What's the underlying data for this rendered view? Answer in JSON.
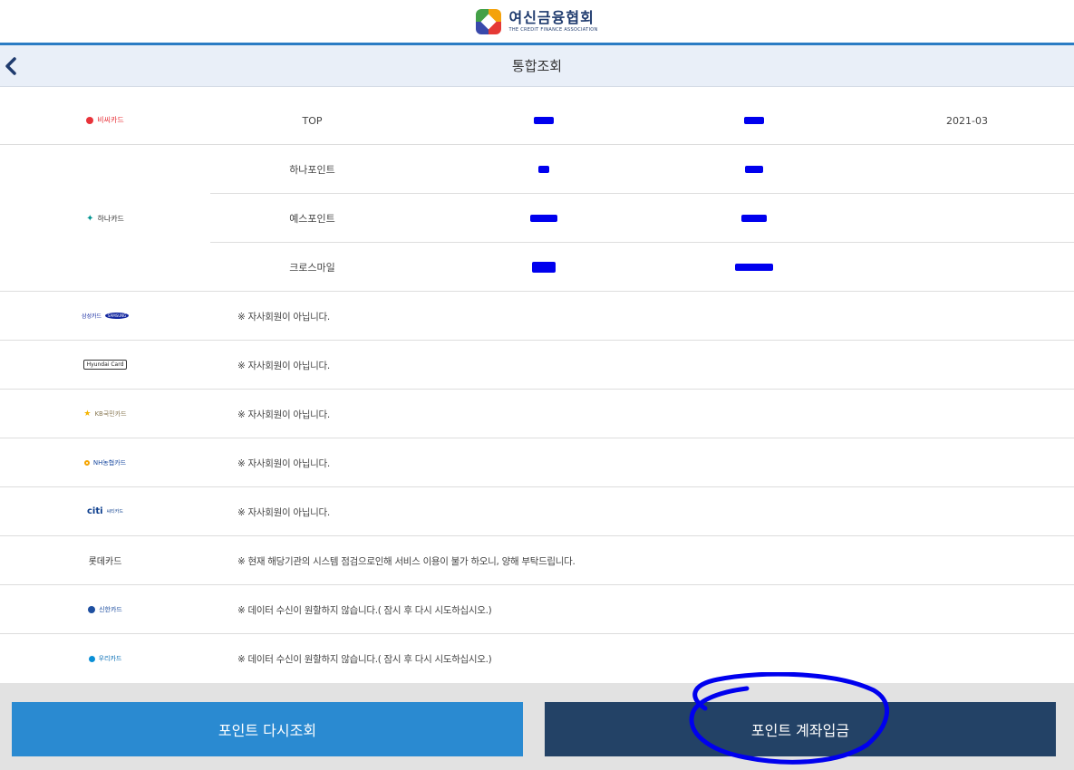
{
  "brand": {
    "name_ko": "여신금융협회",
    "name_en": "THE CREDIT FINANCE ASSOCIATION"
  },
  "header": {
    "title": "통합조회",
    "back_icon": "chevron-left-icon"
  },
  "cards": {
    "bc": {
      "logo_text": "비씨카드",
      "point_name": "TOP",
      "date": "2021-03"
    },
    "hana": {
      "logo_text": "하나카드",
      "points": [
        {
          "name": "하나포인트"
        },
        {
          "name": "예스포인트"
        },
        {
          "name": "크로스마일"
        }
      ]
    },
    "samsung": {
      "logo_text": "삼성카드",
      "brand_text": "SAMSUNG",
      "message": "※ 자사회원이 아닙니다."
    },
    "hyundai": {
      "logo_text": "Hyundai Card",
      "message": "※ 자사회원이 아닙니다."
    },
    "kb": {
      "logo_text": "KB국민카드",
      "message": "※ 자사회원이 아닙니다."
    },
    "nh": {
      "logo_text": "NH농협카드",
      "message": "※ 자사회원이 아닙니다."
    },
    "citi": {
      "logo_text": "citi",
      "sub_text": "씨티카드",
      "message": "※ 자사회원이 아닙니다."
    },
    "lotte": {
      "logo_text": "롯데카드",
      "message": "※ 현재 해당기관의 시스템 점검으로인해 서비스 이용이 불가 하오니, 양해 부탁드립니다."
    },
    "shinhan": {
      "logo_text": "신한카드",
      "message": "※ 데이터 수신이 원할하지 않습니다.( 잠시 후 다시 시도하십시오.)"
    },
    "woori": {
      "logo_text": "우리카드",
      "message": "※ 데이터 수신이 원할하지 않습니다.( 잠시 후 다시 시도하십시오.)"
    }
  },
  "buttons": {
    "refresh": "포인트 다시조회",
    "deposit": "포인트 계좌입금"
  },
  "colors": {
    "accent": "#2b7cc4",
    "refresh_button": "#2a8ad1",
    "deposit_button": "#234266",
    "redaction": "#0000ee",
    "annotation": "#0000ee"
  }
}
